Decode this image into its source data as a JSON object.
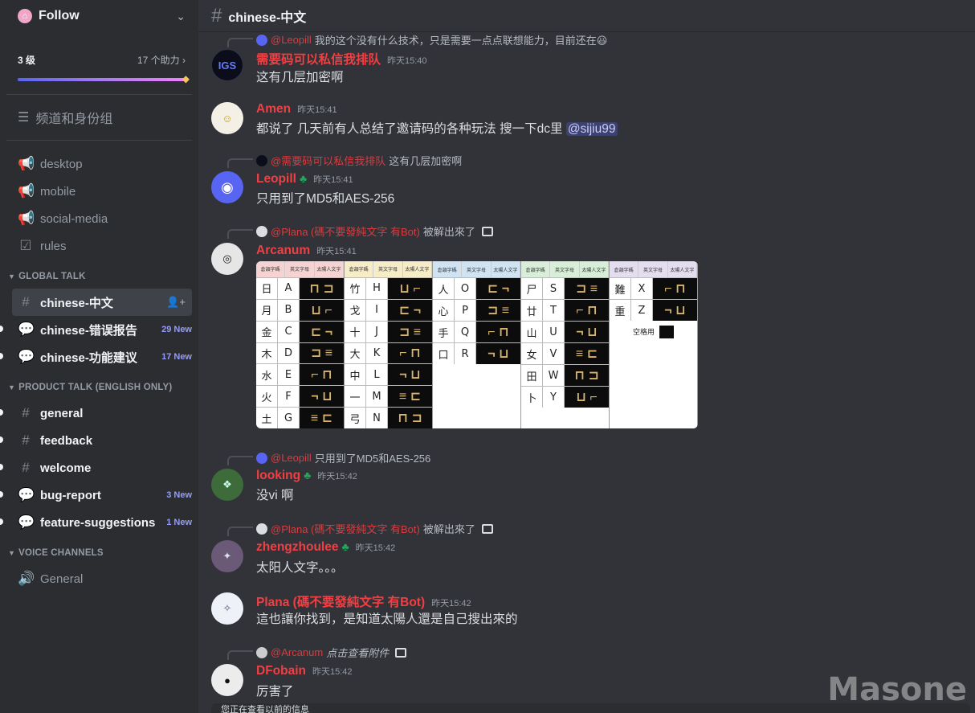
{
  "server": {
    "name": "Follow"
  },
  "boost": {
    "level": "3 级",
    "count": "17 个助力",
    "progress": 1.0
  },
  "roles_label": "频道和身份组",
  "channels_top": [
    {
      "label": "desktop"
    },
    {
      "label": "mobile"
    },
    {
      "label": "social-media"
    },
    {
      "label": "rules"
    }
  ],
  "categories": {
    "global": "GLOBAL TALK",
    "product": "PRODUCT TALK (ENGLISH ONLY)",
    "voice": "VOICE CHANNELS"
  },
  "global_channels": [
    {
      "label": "chinese-中文",
      "badge": ""
    },
    {
      "label": "chinese-错误报告",
      "badge": "29 New"
    },
    {
      "label": "chinese-功能建议",
      "badge": "17 New"
    }
  ],
  "product_channels": [
    {
      "label": "general",
      "badge": ""
    },
    {
      "label": "feedback",
      "badge": ""
    },
    {
      "label": "welcome",
      "badge": ""
    },
    {
      "label": "bug-report",
      "badge": "3 New"
    },
    {
      "label": "feature-suggestions",
      "badge": "1 New"
    }
  ],
  "voice_channels": [
    {
      "label": "General"
    }
  ],
  "topbar": {
    "title": "chinese-中文"
  },
  "messages": {
    "m0": {
      "reply_who": "@Leopill",
      "reply_text": "我的这个没有什么技术，只是需要一点点联想能力，目前还在😃",
      "user": "需要码可以私信我排队",
      "time": "昨天15:40",
      "text": "这有几层加密啊"
    },
    "m1": {
      "user": "Amen",
      "time": "昨天15:41",
      "text": "都说了 几天前有人总结了邀请码的各种玩法 搜一下dc里",
      "mention": "@sijiu99"
    },
    "m2": {
      "reply_who": "@需要码可以私信我排队",
      "reply_text": "这有几层加密啊",
      "user": "Leopill",
      "time": "昨天15:41",
      "text": "只用到了MD5和AES-256"
    },
    "m3": {
      "reply_who": "@Plana (碼不要發純文字 有Bot)",
      "reply_text": "被解出來了",
      "user": "Arcanum",
      "time": "昨天15:41"
    },
    "m4": {
      "reply_who": "@Leopill",
      "reply_text": "只用到了MD5和AES-256",
      "user": "looking",
      "time": "昨天15:42",
      "text": "没vi 啊"
    },
    "m5": {
      "reply_who": "@Plana (碼不要發純文字 有Bot)",
      "reply_text": "被解出來了",
      "user": "zhengzhoulee",
      "time": "昨天15:42",
      "text": "太阳人文字。。。"
    },
    "m6": {
      "user": "Plana (碼不要發純文字 有Bot)",
      "time": "昨天15:42",
      "text": "這也讓你找到，是知道太陽人還是自己搜出來的"
    },
    "m7": {
      "reply_who": "@Arcanum",
      "reply_text": "点击查看附件",
      "user": "DFobain",
      "time": "昨天15:42",
      "text": "厉害了"
    }
  },
  "attachment": {
    "header": [
      "倉頡字碼",
      "英文字母",
      "太陽人文字"
    ],
    "blocks": [
      {
        "rows": [
          [
            "日",
            "A"
          ],
          [
            "月",
            "B"
          ],
          [
            "金",
            "C"
          ],
          [
            "木",
            "D"
          ],
          [
            "水",
            "E"
          ],
          [
            "火",
            "F"
          ],
          [
            "土",
            "G"
          ]
        ]
      },
      {
        "rows": [
          [
            "竹",
            "H"
          ],
          [
            "戈",
            "I"
          ],
          [
            "十",
            "J"
          ],
          [
            "大",
            "K"
          ],
          [
            "中",
            "L"
          ],
          [
            "一",
            "M"
          ],
          [
            "弓",
            "N"
          ]
        ]
      },
      {
        "rows": [
          [
            "人",
            "O"
          ],
          [
            "心",
            "P"
          ],
          [
            "手",
            "Q"
          ],
          [
            "口",
            "R"
          ]
        ]
      },
      {
        "rows": [
          [
            "尸",
            "S"
          ],
          [
            "廿",
            "T"
          ],
          [
            "山",
            "U"
          ],
          [
            "女",
            "V"
          ],
          [
            "田",
            "W"
          ],
          [
            "卜",
            "Y"
          ]
        ]
      },
      {
        "rows": [
          [
            "難",
            "X"
          ],
          [
            "重",
            "Z"
          ]
        ],
        "space_label": "空格用"
      }
    ]
  },
  "watermark": "Masone",
  "bottom_notice": "您正在查看以前的信息"
}
